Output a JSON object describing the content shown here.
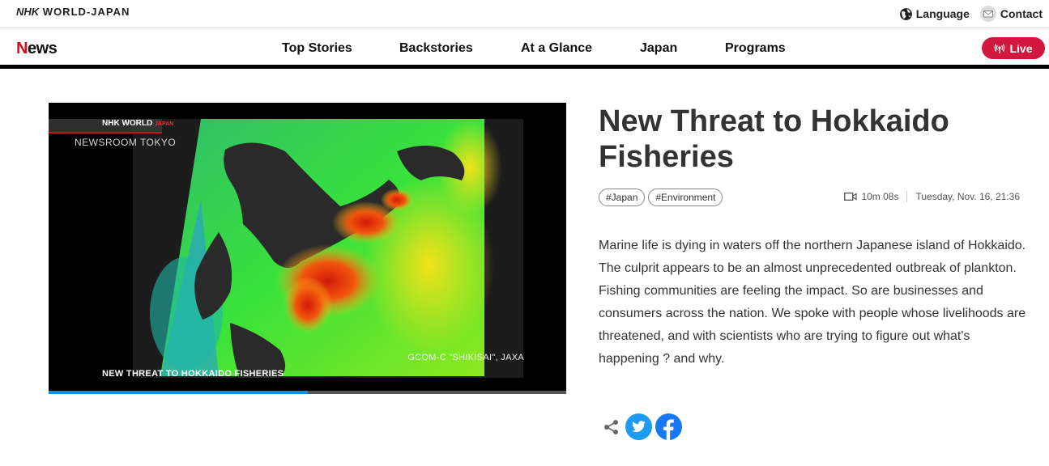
{
  "header": {
    "brand_main": "NHK",
    "brand_sub": "WORLD-JAPAN",
    "language_label": "Language",
    "contact_label": "Contact"
  },
  "nav": {
    "section": "News",
    "items": [
      "Top Stories",
      "Backstories",
      "At a Glance",
      "Japan",
      "Programs"
    ],
    "live_label": "Live"
  },
  "video": {
    "logo_text": "NHK WORLD",
    "logo_sub": "JAPAN",
    "newsroom": "NEWSROOM TOKYO",
    "credit": "GCOM-C \"SHIKISAI\", JAXA",
    "caption": "NEW THREAT TO HOKKAIDO FISHERIES",
    "progress": 0.5
  },
  "article": {
    "title": "New Threat to Hokkaido Fisheries",
    "tags": [
      "#Japan",
      "#Environment"
    ],
    "duration": "10m 08s",
    "date": "Tuesday, Nov. 16, 21:36",
    "summary": "Marine life is dying in waters off the northern Japanese island of Hokkaido. The culprit appears to be an almost unprecedented outbreak of plankton. Fishing communities are feeling the impact. So are businesses and consumers across the nation. We spoke with people whose livelihoods are threatened, and with scientists who are trying to figure out what's happening ? and why."
  },
  "colors": {
    "live": "#d1183f",
    "twitter": "#1d9bf0",
    "facebook": "#1877f2",
    "progress": "#1a8cd8"
  },
  "icons": [
    "globe-icon",
    "mail-icon",
    "broadcast-icon",
    "video-camera-icon",
    "share-icon",
    "twitter-icon",
    "facebook-icon"
  ]
}
